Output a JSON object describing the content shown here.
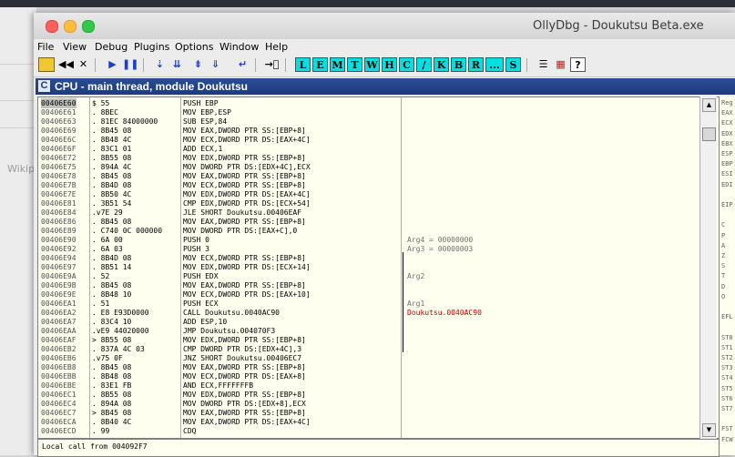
{
  "window": {
    "title": "OllyDbg - Doukutsu Beta.exe"
  },
  "background": {
    "left_text": "Wikip"
  },
  "menu": [
    "File",
    "View",
    "Debug",
    "Plugins",
    "Options",
    "Window",
    "Help"
  ],
  "toolbar": {
    "letters": [
      "L",
      "E",
      "M",
      "T",
      "W",
      "H",
      "C",
      "/",
      "K",
      "B",
      "R",
      "...",
      "S"
    ]
  },
  "cpu": {
    "title": "CPU - main thread, module Doukutsu"
  },
  "rows": [
    {
      "addr": "00406E60",
      "hex": "$ 55",
      "dis": "PUSH EBP",
      "cmt": ""
    },
    {
      "addr": "00406E61",
      "hex": ". 8BEC",
      "dis": "MOV EBP,ESP",
      "cmt": ""
    },
    {
      "addr": "00406E63",
      "hex": ". 81EC 84000000",
      "dis": "SUB ESP,84",
      "cmt": ""
    },
    {
      "addr": "00406E69",
      "hex": ". 8B45 08",
      "dis": "MOV EAX,DWORD PTR SS:[EBP+8]",
      "cmt": ""
    },
    {
      "addr": "00406E6C",
      "hex": ". 8B48 4C",
      "dis": "MOV ECX,DWORD PTR DS:[EAX+4C]",
      "cmt": ""
    },
    {
      "addr": "00406E6F",
      "hex": ". 83C1 01",
      "dis": "ADD ECX,1",
      "cmt": ""
    },
    {
      "addr": "00406E72",
      "hex": ". 8B55 08",
      "dis": "MOV EDX,DWORD PTR SS:[EBP+8]",
      "cmt": ""
    },
    {
      "addr": "00406E75",
      "hex": ". 894A 4C",
      "dis": "MOV DWORD PTR DS:[EDX+4C],ECX",
      "cmt": ""
    },
    {
      "addr": "00406E78",
      "hex": ". 8B45 08",
      "dis": "MOV EAX,DWORD PTR SS:[EBP+8]",
      "cmt": ""
    },
    {
      "addr": "00406E7B",
      "hex": ". 8B4D 08",
      "dis": "MOV ECX,DWORD PTR SS:[EBP+8]",
      "cmt": ""
    },
    {
      "addr": "00406E7E",
      "hex": ". 8B50 4C",
      "dis": "MOV EDX,DWORD PTR DS:[EAX+4C]",
      "cmt": ""
    },
    {
      "addr": "00406E81",
      "hex": ". 3B51 54",
      "dis": "CMP EDX,DWORD PTR DS:[ECX+54]",
      "cmt": ""
    },
    {
      "addr": "00406E84",
      "hex": ".v7E 29",
      "dis": "JLE SHORT Doukutsu.00406EAF",
      "cmt": ""
    },
    {
      "addr": "00406E86",
      "hex": ". 8B45 08",
      "dis": "MOV EAX,DWORD PTR SS:[EBP+8]",
      "cmt": ""
    },
    {
      "addr": "00406E89",
      "hex": ". C740 0C 000000",
      "dis": "MOV DWORD PTR DS:[EAX+C],0",
      "cmt": ""
    },
    {
      "addr": "00406E90",
      "hex": ". 6A 00",
      "dis": "PUSH 0",
      "cmt": "Arg4 = 00000000"
    },
    {
      "addr": "00406E92",
      "hex": ". 6A 03",
      "dis": "PUSH 3",
      "cmt": "Arg3 = 00000003"
    },
    {
      "addr": "00406E94",
      "hex": ". 8B4D 08",
      "dis": "MOV ECX,DWORD PTR SS:[EBP+8]",
      "cmt": ""
    },
    {
      "addr": "00406E97",
      "hex": ". 8B51 14",
      "dis": "MOV EDX,DWORD PTR DS:[ECX+14]",
      "cmt": ""
    },
    {
      "addr": "00406E9A",
      "hex": ". 52",
      "dis": "PUSH EDX",
      "cmt": "Arg2"
    },
    {
      "addr": "00406E9B",
      "hex": ". 8B45 08",
      "dis": "MOV EAX,DWORD PTR SS:[EBP+8]",
      "cmt": ""
    },
    {
      "addr": "00406E9E",
      "hex": ". 8B48 10",
      "dis": "MOV ECX,DWORD PTR DS:[EAX+10]",
      "cmt": ""
    },
    {
      "addr": "00406EA1",
      "hex": ". 51",
      "dis": "PUSH ECX",
      "cmt": "Arg1"
    },
    {
      "addr": "00406EA2",
      "hex": ". E8 E93D0000",
      "dis": "CALL Doukutsu.0040AC90",
      "cmt": "Doukutsu.0040AC90"
    },
    {
      "addr": "00406EA7",
      "hex": ". 83C4 10",
      "dis": "ADD ESP,10",
      "cmt": ""
    },
    {
      "addr": "00406EAA",
      "hex": ".vE9 44020000",
      "dis": "JMP Doukutsu.004070F3",
      "cmt": ""
    },
    {
      "addr": "00406EAF",
      "hex": "> 8B55 08",
      "dis": "MOV EDX,DWORD PTR SS:[EBP+8]",
      "cmt": ""
    },
    {
      "addr": "00406EB2",
      "hex": ". 837A 4C 03",
      "dis": "CMP DWORD PTR DS:[EDX+4C],3",
      "cmt": ""
    },
    {
      "addr": "00406EB6",
      "hex": ".v75 0F",
      "dis": "JNZ SHORT Doukutsu.00406EC7",
      "cmt": ""
    },
    {
      "addr": "00406EB8",
      "hex": ". 8B45 08",
      "dis": "MOV EAX,DWORD PTR SS:[EBP+8]",
      "cmt": ""
    },
    {
      "addr": "00406EBB",
      "hex": ". 8B48 08",
      "dis": "MOV ECX,DWORD PTR DS:[EAX+8]",
      "cmt": ""
    },
    {
      "addr": "00406EBE",
      "hex": ". 83E1 FB",
      "dis": "AND ECX,FFFFFFFB",
      "cmt": ""
    },
    {
      "addr": "00406EC1",
      "hex": ". 8B55 08",
      "dis": "MOV EDX,DWORD PTR SS:[EBP+8]",
      "cmt": ""
    },
    {
      "addr": "00406EC4",
      "hex": ". 894A 08",
      "dis": "MOV DWORD PTR DS:[EDX+8],ECX",
      "cmt": ""
    },
    {
      "addr": "00406EC7",
      "hex": "> 8B45 08",
      "dis": "MOV EAX,DWORD PTR SS:[EBP+8]",
      "cmt": ""
    },
    {
      "addr": "00406ECA",
      "hex": ". 8B40 4C",
      "dis": "MOV EAX,DWORD PTR DS:[EAX+4C]",
      "cmt": ""
    },
    {
      "addr": "00406ECD",
      "hex": ". 99",
      "dis": "CDQ",
      "cmt": ""
    }
  ],
  "info_line": "Local call from 004092F7",
  "registers": [
    "Reg",
    "EAX",
    "ECX",
    "EDX",
    "EBX",
    "ESP",
    "EBP",
    "ESI",
    "EDI",
    "",
    "EIP",
    "",
    "C",
    "P",
    "A",
    "Z",
    "S",
    "T",
    "D",
    "O",
    "",
    "EFL",
    "",
    "ST0",
    "ST1",
    "ST2",
    "ST3",
    "ST4",
    "ST5",
    "ST6",
    "ST7",
    "",
    "FST",
    "FCW"
  ]
}
